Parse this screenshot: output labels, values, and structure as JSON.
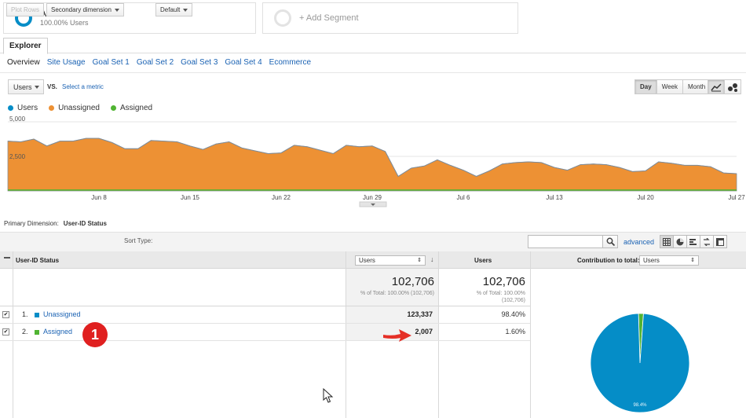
{
  "segments": {
    "primary": {
      "title": "All Users",
      "subtitle": "100.00% Users"
    },
    "add_label": "+ Add Segment"
  },
  "tabs": {
    "explorer": "Explorer"
  },
  "subtabs": [
    "Overview",
    "Site Usage",
    "Goal Set 1",
    "Goal Set 2",
    "Goal Set 3",
    "Goal Set 4",
    "Ecommerce"
  ],
  "chart_controls": {
    "metric": "Users",
    "vs": "VS.",
    "select_metric": "Select a metric",
    "periods": [
      "Day",
      "Week",
      "Month"
    ],
    "active_period": "Day"
  },
  "colors": {
    "users": "#058dc7",
    "unassigned": "#ed9134",
    "assigned": "#50b432",
    "link": "#1a62b3"
  },
  "chart_data": {
    "type": "area",
    "series": [
      {
        "name": "Users",
        "color": "#058dc7"
      },
      {
        "name": "Unassigned",
        "color": "#ed9134"
      },
      {
        "name": "Assigned",
        "color": "#50b432"
      }
    ],
    "y_ticks": [
      "5,000",
      "2,500"
    ],
    "ylim": [
      0,
      5000
    ],
    "x_tick_labels": [
      "Jun 8",
      "Jun 15",
      "Jun 22",
      "Jun 29",
      "Jul 6",
      "Jul 13",
      "Jul 20",
      "Jul 27"
    ],
    "unassigned_values": [
      3600,
      3550,
      3750,
      3250,
      3600,
      3600,
      3800,
      3800,
      3500,
      3050,
      3050,
      3650,
      3600,
      3550,
      3250,
      3000,
      3400,
      3550,
      3100,
      2900,
      2700,
      2750,
      3300,
      3200,
      2950,
      2700,
      3300,
      3200,
      3250,
      2850,
      1050,
      1650,
      1800,
      2250,
      1850,
      1500,
      1050,
      1450,
      1950,
      2050,
      2100,
      2050,
      1700,
      1500,
      1900,
      1950,
      1900,
      1700,
      1400,
      1450,
      2100,
      2000,
      1850,
      1850,
      1750,
      1300,
      1250
    ],
    "assigned_values": [
      60,
      60,
      60,
      60,
      60,
      60,
      60,
      60,
      60,
      60,
      60,
      60,
      60,
      60,
      60,
      60,
      60,
      60,
      60,
      60,
      60,
      60,
      60,
      60,
      60,
      60,
      60,
      60,
      60,
      60,
      60,
      60,
      60,
      60,
      60,
      60,
      60,
      60,
      60,
      60,
      60,
      60,
      60,
      60,
      60,
      60,
      60,
      60,
      60,
      60,
      60,
      60,
      60,
      60,
      60,
      60,
      60
    ]
  },
  "table": {
    "primary_dimension_label": "Primary Dimension:",
    "primary_dimension_value": "User-ID Status",
    "plot_rows": "Plot Rows",
    "secondary_dimension": "Secondary dimension",
    "sort_type_label": "Sort Type:",
    "sort_type": "Default",
    "advanced": "advanced",
    "header_dim": "User-ID Status",
    "header_metric_select": "Users",
    "header_users": "Users",
    "header_contribution": "Contribution to total:",
    "contribution_metric": "Users",
    "totals": {
      "value1": "102,706",
      "sub1": "% of Total: 100.00% (102,706)",
      "value2": "102,706",
      "sub2a": "% of Total: 100.00%",
      "sub2b": "(102,706)"
    },
    "rows": [
      {
        "index": "1.",
        "label": "Unassigned",
        "value": "123,337",
        "percent": "98.40%",
        "color": "#058dc7"
      },
      {
        "index": "2.",
        "label": "Assigned",
        "value": "2,007",
        "percent": "1.60%",
        "color": "#50b432"
      }
    ]
  },
  "pie": {
    "label": "98.4%",
    "slices": [
      {
        "value": 98.4,
        "color": "#058dc7"
      },
      {
        "value": 1.6,
        "color": "#50b432"
      }
    ]
  },
  "annotation": {
    "badge": "1"
  }
}
